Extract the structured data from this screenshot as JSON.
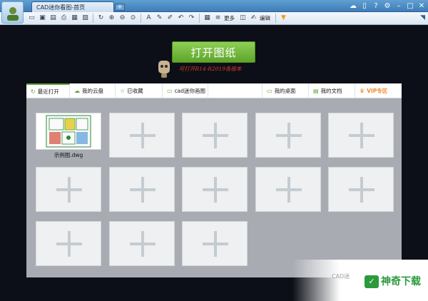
{
  "window": {
    "title": "CAD迷你看图-首页",
    "new_tab_label": "+"
  },
  "toolbar": {
    "more_label": "更多",
    "edit_label": "编辑"
  },
  "main": {
    "open_button_label": "打开图纸",
    "mascot_text": "可打开R14-R2019各版本"
  },
  "nav": {
    "items": [
      {
        "label": "最近打开",
        "icon": "refresh-icon"
      },
      {
        "label": "我的云盘",
        "icon": "cloud-icon"
      },
      {
        "label": "已收藏",
        "icon": "star-icon"
      },
      {
        "label": "cad迷你画图",
        "icon": "screen-icon"
      },
      {
        "label": "我的桌面",
        "icon": "desktop-icon"
      },
      {
        "label": "我的文档",
        "icon": "folder-icon"
      },
      {
        "label": "VIP专区",
        "icon": "crown-icon"
      }
    ]
  },
  "files": [
    {
      "name": "示例图.dwg"
    }
  ],
  "watermark": {
    "cad_text": "CAD迷",
    "site_text": "神奇下载",
    "logo_glyph": "✓"
  },
  "colors": {
    "accent_green": "#5aa335",
    "vip_orange": "#f08a2a",
    "title_blue": "#3f7db8",
    "mascot_red": "#d83a2a"
  }
}
